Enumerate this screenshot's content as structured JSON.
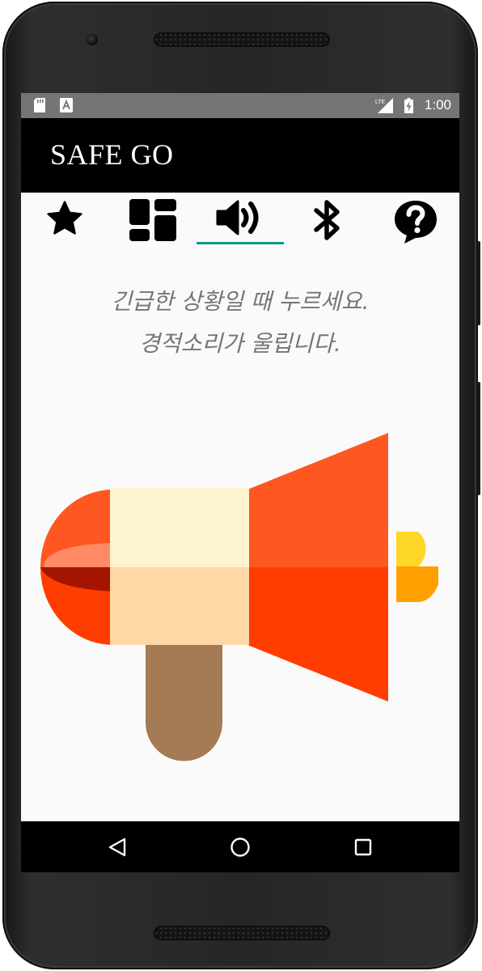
{
  "status_bar": {
    "time": "1:00",
    "network": "LTE",
    "icons": [
      "sd-card-icon",
      "text-notification-icon",
      "lte-signal-icon",
      "battery-charging-icon"
    ]
  },
  "app_bar": {
    "title": "SAFE GO"
  },
  "tabs": [
    {
      "icon": "star-icon",
      "selected": false
    },
    {
      "icon": "dashboard-icon",
      "selected": false
    },
    {
      "icon": "volume-icon",
      "selected": true
    },
    {
      "icon": "bluetooth-icon",
      "selected": false
    },
    {
      "icon": "help-bubble-icon",
      "selected": false
    }
  ],
  "main": {
    "message_line1": "긴급한 상황일 때 누르세요.",
    "message_line2": "경적소리가 울립니다.",
    "alarm_icon": "megaphone-icon"
  },
  "nav_bar": {
    "buttons": [
      "back-icon",
      "home-icon",
      "recents-icon"
    ]
  },
  "colors": {
    "app_bar": "#000000",
    "status_bar": "#757575",
    "tab_indicator": "#109a88",
    "message_text": "#757575",
    "megaphone_cone": "#ff5722",
    "megaphone_handle": "#a47b55"
  }
}
